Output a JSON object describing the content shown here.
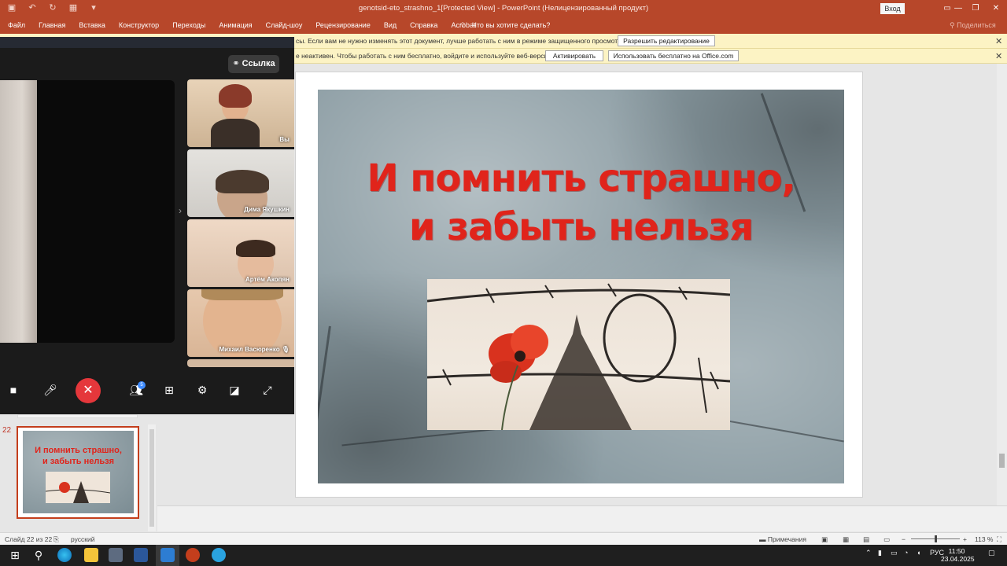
{
  "window": {
    "title": "genotsid-eto_strashno_1[Protected View]  -  PowerPoint (Нелицензированный продукт)",
    "signin": "Вход",
    "minimize": "—",
    "restore": "❐",
    "close": "✕"
  },
  "ribbon": {
    "tabs": [
      "Файл",
      "Главная",
      "Вставка",
      "Конструктор",
      "Переходы",
      "Анимация",
      "Слайд-шоу",
      "Рецензирование",
      "Вид",
      "Справка",
      "Acrobat"
    ],
    "tell_me": "Что вы хотите сделать?",
    "share": "Поделиться"
  },
  "message_bars": [
    {
      "text": "сы. Если вам не нужно изменять этот документ, лучше работать с ним в режиме защищенного просмотра.",
      "buttons": [
        "Разрешить редактирование"
      ]
    },
    {
      "text": "е неактивен. Чтобы работать с ним бесплатно, войдите и используйте веб-версию.",
      "buttons": [
        "Активировать",
        "Использовать бесплатно на Office.com"
      ]
    }
  ],
  "slide": {
    "title_line1": "И помнить страшно,",
    "title_line2": "и забыть нельзя"
  },
  "thumbnail": {
    "number": "22",
    "title_line1": "И помнить страшно,",
    "title_line2": "и забыть нельзя"
  },
  "statusbar": {
    "slide_info": "Слайд 22 из 22",
    "language": "русский",
    "notes": "Примечания",
    "zoom": "113 %"
  },
  "call": {
    "link_label": "Ссылка",
    "participants": [
      {
        "name": "Вы"
      },
      {
        "name": "Дима Якушкин"
      },
      {
        "name": "Артём Акопян"
      },
      {
        "name": "Михаил Васюренко"
      }
    ],
    "participants_badge": "5"
  },
  "taskbar": {
    "lang": "РУС",
    "time": "11:50",
    "date": "23.04.2025"
  },
  "colors": {
    "accent": "#b7472a",
    "slide_title": "#e0241b",
    "end_call": "#e5373b"
  }
}
